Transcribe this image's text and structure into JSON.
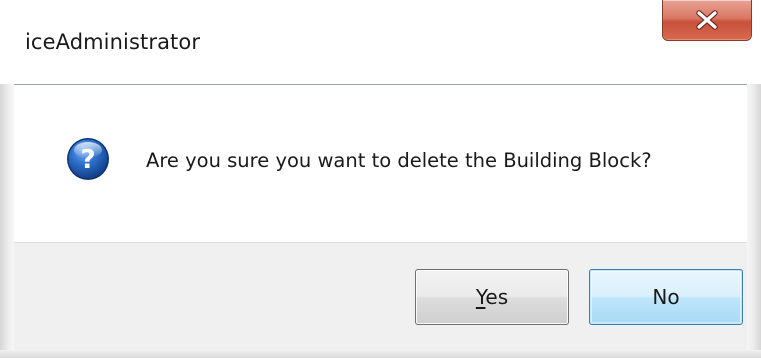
{
  "window": {
    "title": "iceAdministrator",
    "close_icon": "close-icon",
    "close_color": "#c9503a"
  },
  "dialog": {
    "icon": "question-icon",
    "icon_color": "#1f5fb3",
    "message": "Are you sure you want to delete the Building Block?"
  },
  "buttons": {
    "yes": {
      "mnemonic": "Y",
      "rest": "es"
    },
    "no": {
      "label": "No"
    }
  },
  "colors": {
    "button_area": "#f0f0f0",
    "default_button_border": "#3c7fb1"
  }
}
